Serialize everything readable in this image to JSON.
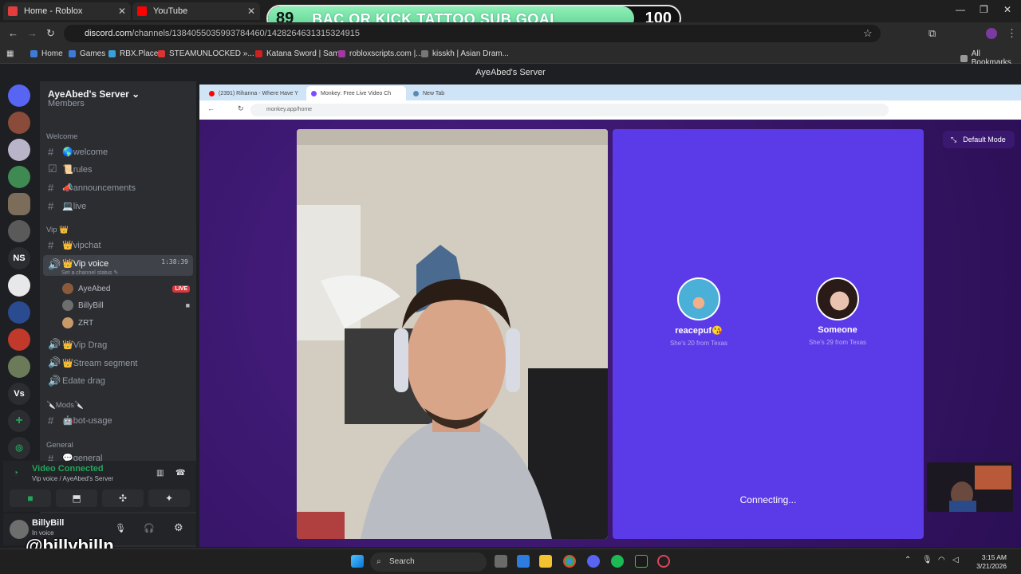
{
  "outer_tabs": [
    {
      "label": "Home - Roblox",
      "color": "#e33d3d"
    },
    {
      "label": "YouTube",
      "color": "#ff0000"
    }
  ],
  "sub_goal": {
    "title": "BAC OR KICK TATTOO SUB GOAL",
    "current": "89",
    "target": "100",
    "progress": 0.89
  },
  "url": {
    "host": "discord.com",
    "path": "/channels/1384055035993784460/1428264631315324915"
  },
  "bookmarks": [
    "Home",
    "Games",
    "RBX.Place",
    "STEAMUNLOCKED »...",
    "Katana Sword | Sam...",
    "robloxscripts.com |...",
    "kisskh | Asian Dram...",
    "All Bookmarks"
  ],
  "window_title": "AyeAbed's Server",
  "server": {
    "name": "AyeAbed's Server",
    "partial_top": "Members",
    "categories": {
      "welcome": "Welcome",
      "vip": "Vip 👑",
      "mods": "🔪Mods🔪",
      "general": "General"
    },
    "channels": {
      "welcome": "🌎welcome",
      "rules": "📜rules",
      "announcements": "📣announcements",
      "live": "💻live",
      "vipchat": "👑vipchat",
      "vip_voice": "👑Vip voice",
      "vip_voice_timer": "1:38:39",
      "vip_voice_status": "Set a channel status",
      "vip_drag": "👑Vip Drag",
      "stream_segment": "👑Stream segment",
      "edate_drag": "Edate drag",
      "bot_usage": "🤖bot-usage",
      "general_partial": "💬general"
    },
    "voice_users": [
      {
        "name": "AyeAbed",
        "badge": "LIVE"
      },
      {
        "name": "BillyBill",
        "badge": ""
      },
      {
        "name": "ZRT",
        "badge": ""
      }
    ]
  },
  "voice_panel": {
    "status": "Video Connected",
    "location": "Vip voice / AyeAbed's Server"
  },
  "user_panel": {
    "name": "BillyBill",
    "status": "In voice"
  },
  "overlay_handle": "@billybilln",
  "guild_labels": {
    "ns": "NS",
    "vs": "Vs"
  },
  "inner_browser": {
    "tabs": [
      "(2391) Rihanna - Where Have Y",
      "Monkey: Free Live Video Ch",
      "New Tab"
    ],
    "url": "monkey.app/home"
  },
  "monkey": {
    "mode_button": "Default Mode",
    "matches": [
      {
        "name": "reacepuf😘",
        "sub": "She's 20 from Texas"
      },
      {
        "name": "Someone",
        "sub": "She's 29 from Texas"
      }
    ],
    "status": "Connecting..."
  },
  "taskbar": {
    "search_placeholder": "Search",
    "time": "3:15 AM",
    "date": "3/21/2026"
  }
}
